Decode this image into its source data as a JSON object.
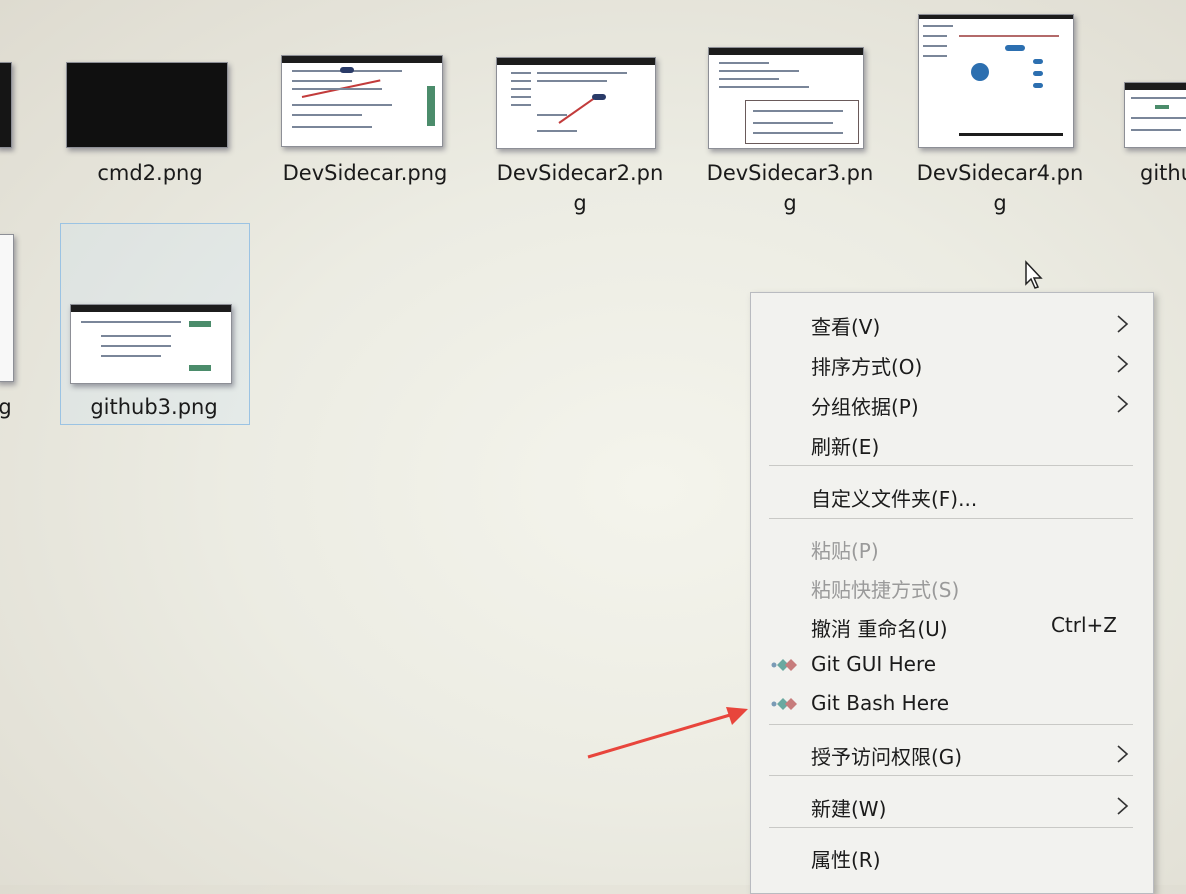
{
  "files": [
    {
      "name": "cmd2.png"
    },
    {
      "name": "DevSidecar.png"
    },
    {
      "name": "DevSidecar2.pn\ng"
    },
    {
      "name": "DevSidecar3.pn\ng"
    },
    {
      "name": "DevSidecar4.pn\ng"
    },
    {
      "name": "githu"
    },
    {
      "name": "github3.png"
    },
    {
      "name": "g"
    }
  ],
  "context_menu": {
    "items": [
      {
        "label": "查看(V)",
        "submenu": true
      },
      {
        "label": "排序方式(O)",
        "submenu": true
      },
      {
        "label": "分组依据(P)",
        "submenu": true
      },
      {
        "label": "刷新(E)"
      },
      {
        "label": "自定义文件夹(F)..."
      },
      {
        "label": "粘贴(P)",
        "disabled": true
      },
      {
        "label": "粘贴快捷方式(S)",
        "disabled": true
      },
      {
        "label": "撤消 重命名(U)",
        "shortcut": "Ctrl+Z"
      },
      {
        "label": "Git GUI Here",
        "icon": "git-gui-icon"
      },
      {
        "label": "Git Bash Here",
        "icon": "git-bash-icon"
      },
      {
        "label": "授予访问权限(G)",
        "submenu": true
      },
      {
        "label": "新建(W)",
        "submenu": true
      },
      {
        "label": "属性(R)"
      }
    ]
  },
  "colors": {
    "annotation_arrow": "#e8453c",
    "menu_background": "#f2f2ef",
    "selection_border": "#9bc3e3"
  }
}
